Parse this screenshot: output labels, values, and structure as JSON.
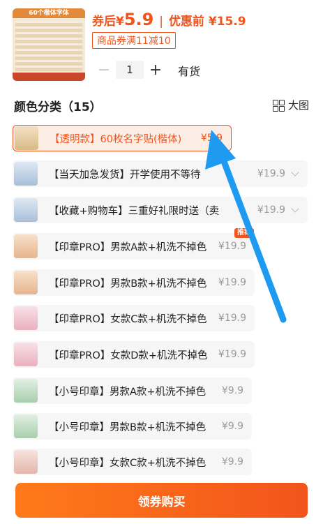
{
  "header": {
    "thumb_caption": "60个楷体字体",
    "price_prefix": "券后¥",
    "price_value": "5.9",
    "separator": "|",
    "original_price": "优惠前 ¥15.9",
    "coupon": "商品券满11减10",
    "quantity": "1",
    "minus": "−",
    "plus": "+",
    "stock": "有货"
  },
  "section": {
    "title": "颜色分类（15）",
    "big_view": "大图"
  },
  "options": [
    {
      "label": "【透明款】60枚名字贴(楷体)",
      "price": "¥5.9"
    },
    {
      "label": "【当天加急发货】开学使用不等待",
      "price": "¥19.9"
    },
    {
      "label": "【收藏+购物车】三重好礼限时送（卖",
      "price": "¥19.9"
    },
    {
      "label": "【印章PRO】男款A款+机洗不掉色",
      "price": "¥19.9",
      "badge": "推荐"
    },
    {
      "label": "【印章PRO】男款B款+机洗不掉色",
      "price": "¥19.9"
    },
    {
      "label": "【印章PRO】女款C款+机洗不掉色",
      "price": "¥19.9"
    },
    {
      "label": "【印章PRO】女款D款+机洗不掉色",
      "price": "¥19.9"
    },
    {
      "label": "【小号印章】男款A款+机洗不掉色",
      "price": "¥9.9"
    },
    {
      "label": "【小号印章】男款B款+机洗不掉色",
      "price": "¥9.9"
    },
    {
      "label": "【小号印章】女款C款+机洗不掉色",
      "price": "¥9.9"
    }
  ],
  "cta": {
    "label": "领券购买"
  },
  "colors": {
    "accent": "#f2541b",
    "arrow": "#1e9bf0"
  }
}
